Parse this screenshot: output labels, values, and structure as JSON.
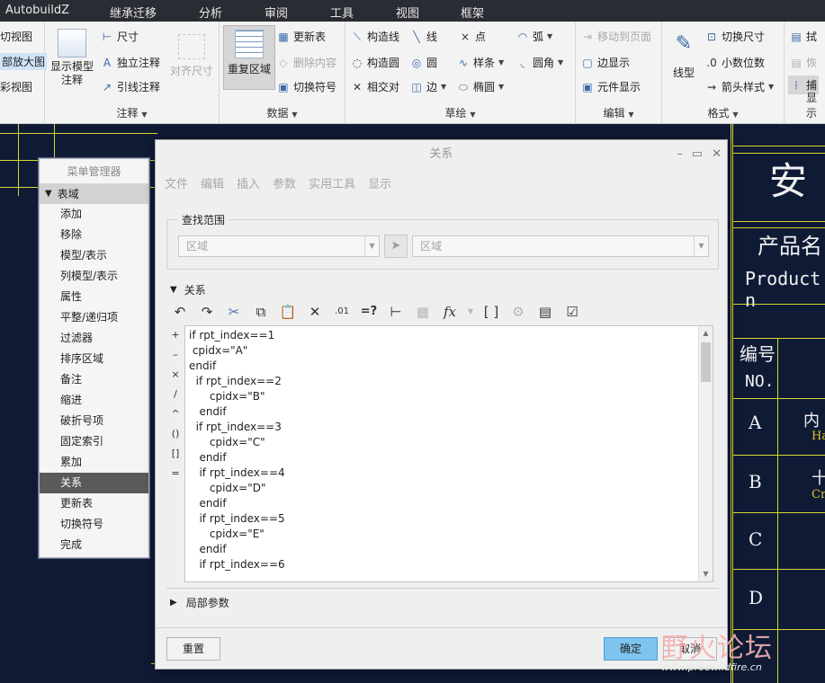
{
  "menubar": {
    "app_name": "AutobuildZ",
    "tabs": [
      "继承迁移",
      "分析",
      "审阅",
      "工具",
      "视图",
      "框架"
    ]
  },
  "ribbon": {
    "views": {
      "items": [
        "切视图",
        "部放大图",
        "彩视图"
      ]
    },
    "annotation": {
      "group_label": "注释",
      "show_model_annot": "显示模型注释",
      "dimension": "尺寸",
      "standalone_annot": "独立注释",
      "leader_annot": "引线注释",
      "align_dimension": "对齐尺寸"
    },
    "data": {
      "group_label": "数据",
      "repeat_region": "重复区域",
      "update_table": "更新表",
      "delete_content": "删除内容",
      "switch_symbol": "切换符号"
    },
    "sketch": {
      "group_label": "草绘",
      "construct_line": "构造线",
      "line": "线",
      "point": "点",
      "arc": "弧",
      "construct_circle": "构造圆",
      "circle": "圆",
      "spline": "样条",
      "fillet": "圆角",
      "intersect": "相交对",
      "edge": "边",
      "ellipse": "椭圆"
    },
    "edit": {
      "group_label": "编辑",
      "move_to_page": "移动到页面",
      "edge_display": "边显示",
      "component_display": "元件显示"
    },
    "format": {
      "group_label": "格式",
      "line_style": "线型",
      "switch_dimension": "切换尺寸",
      "decimal_places": "小数位数",
      "arrow_style": "箭头样式"
    },
    "display": {
      "group_label": "显示",
      "items": [
        "拭",
        "恢",
        "捕"
      ]
    }
  },
  "cad_bg": {
    "title_big": "安",
    "product_name_cn": "产品名",
    "product_name_en": "Product n",
    "table_header_cn": "编号",
    "table_header_en": "NO.",
    "rows": [
      "A",
      "B",
      "C",
      "D"
    ],
    "row_text_a": "内",
    "row_text_a_sub": "Ha",
    "row_text_b": "十",
    "row_text_b_sub": "Cr"
  },
  "menu_manager": {
    "title": "菜单管理器",
    "header": "表域",
    "items": [
      "添加",
      "移除",
      "模型/表示",
      "列模型/表示",
      "属性",
      "平整/递归项",
      "过滤器",
      "排序区域",
      "备注",
      "缩进",
      "破折号项",
      "固定索引",
      "累加",
      "关系",
      "更新表",
      "切换符号",
      "完成"
    ],
    "selected": "关系"
  },
  "dialog": {
    "title": "关系",
    "menu": [
      "文件",
      "编辑",
      "插入",
      "参数",
      "实用工具",
      "显示"
    ],
    "scope_label": "查找范围",
    "scope_combo_1": "区域",
    "scope_combo_2": "区域",
    "relations_label": "关系",
    "operators": [
      "+",
      "–",
      "×",
      "/",
      "^",
      "()",
      "[]",
      "="
    ],
    "code_lines": [
      "if rpt_index==1",
      " cpidx=\"A\"",
      "endif",
      "  if rpt_index==2",
      "      cpidx=\"B\"",
      "   endif",
      "  if rpt_index==3",
      "      cpidx=\"C\"",
      "   endif",
      "   if rpt_index==4",
      "      cpidx=\"D\"",
      "   endif",
      "   if rpt_index==5",
      "      cpidx=\"E\"",
      "   endif",
      "   if rpt_index==6"
    ],
    "local_params_label": "局部参数",
    "reset_button": "重置",
    "ok_button": "确定",
    "cancel_button": "取消"
  },
  "watermark": {
    "text": "野火论坛",
    "url": "www.proewildfire.cn"
  }
}
